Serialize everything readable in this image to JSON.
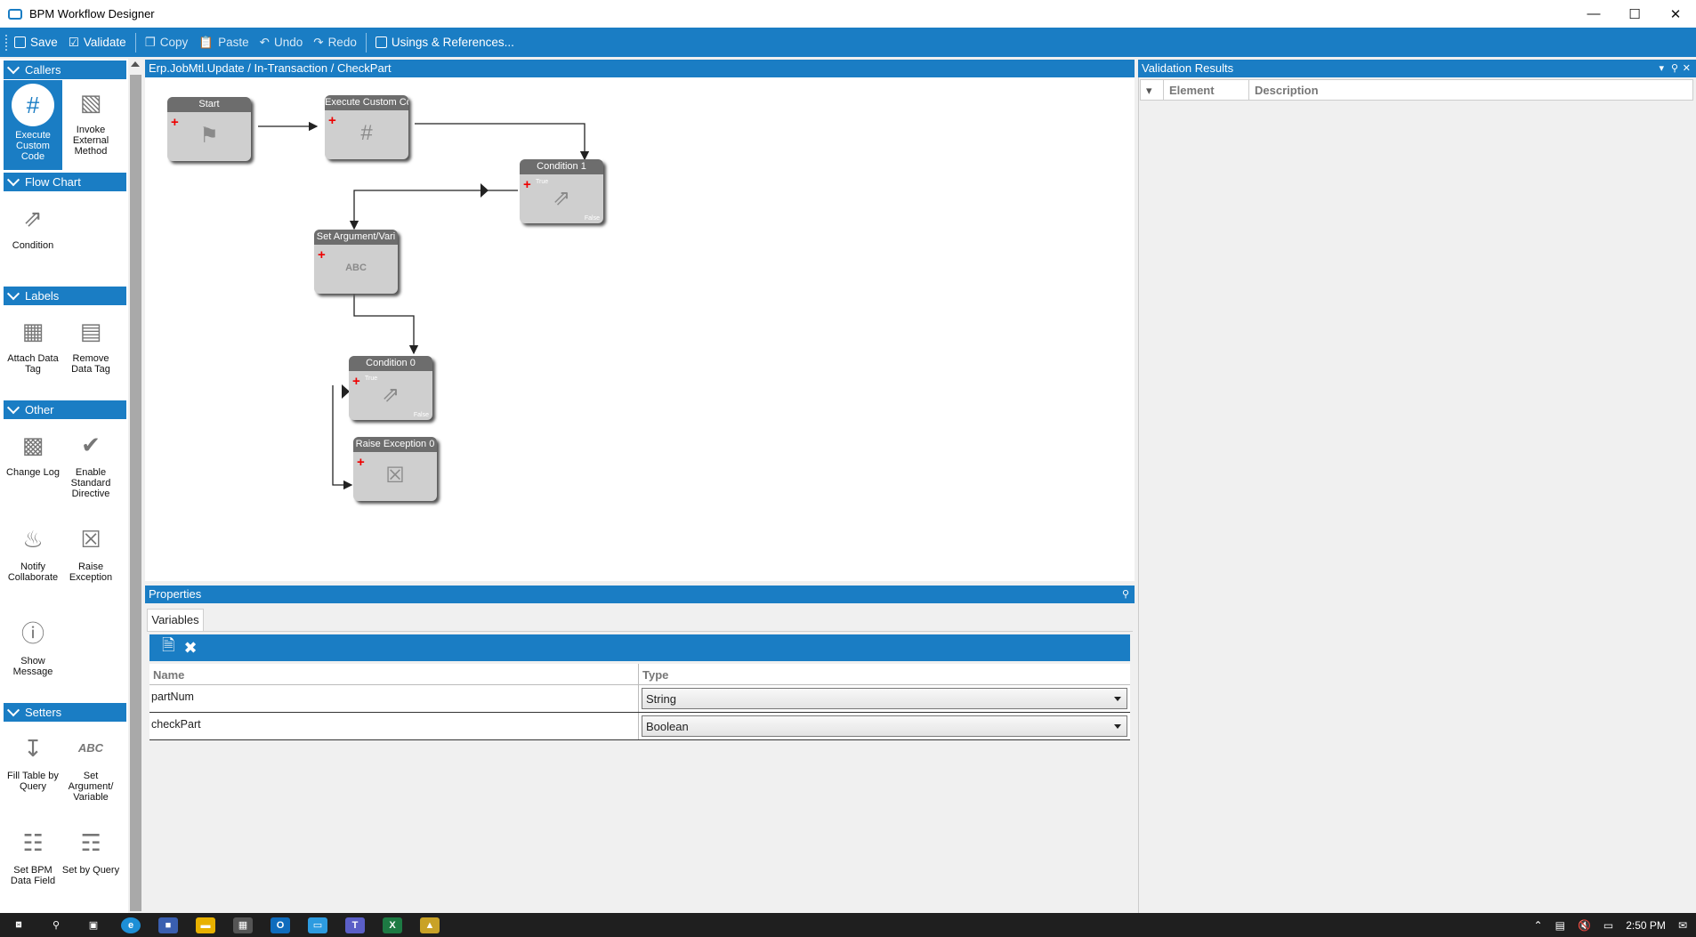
{
  "window": {
    "title": "BPM Workflow Designer"
  },
  "toolbar": {
    "save": "Save",
    "validate": "Validate",
    "copy": "Copy",
    "paste": "Paste",
    "undo": "Undo",
    "redo": "Redo",
    "usings": "Usings & References..."
  },
  "toolbox": {
    "callers": {
      "title": "Callers",
      "items": [
        "Execute Custom Code",
        "Invoke External Method"
      ]
    },
    "flowchart": {
      "title": "Flow Chart",
      "items": [
        "Condition"
      ]
    },
    "labels": {
      "title": "Labels",
      "items": [
        "Attach Data Tag",
        "Remove Data Tag"
      ]
    },
    "other": {
      "title": "Other",
      "items": [
        "Change Log",
        "Enable Standard Directive",
        "Notify Collaborate",
        "Raise Exception",
        "Show Message"
      ]
    },
    "setters": {
      "title": "Setters",
      "items": [
        "Fill Table by Query",
        "Set Argument/ Variable",
        "Set BPM Data Field",
        "Set by Query"
      ]
    }
  },
  "canvas": {
    "breadcrumb": "Erp.JobMtl.Update / In-Transaction / CheckPart",
    "nodes": {
      "start": "Start",
      "execute": "Execute Custom Co",
      "condition1": "Condition 1",
      "setarg": "Set Argument/Vari",
      "condition0": "Condition 0",
      "raise": "Raise Exception 0"
    },
    "node_tiny": {
      "true": "True",
      "false": "False"
    }
  },
  "properties": {
    "title": "Properties",
    "tab": "Variables",
    "columns": {
      "name": "Name",
      "type": "Type"
    },
    "rows": [
      {
        "name": "partNum",
        "type": "String"
      },
      {
        "name": "checkPart",
        "type": "Boolean"
      }
    ]
  },
  "validation": {
    "title": "Validation Results",
    "columns": {
      "element": "Element",
      "description": "Description"
    }
  },
  "taskbar": {
    "time": "2:50 PM"
  },
  "colors": {
    "accent": "#1a7dc4",
    "node_header": "#6d6d6d",
    "node_body": "#cfcfcf"
  }
}
